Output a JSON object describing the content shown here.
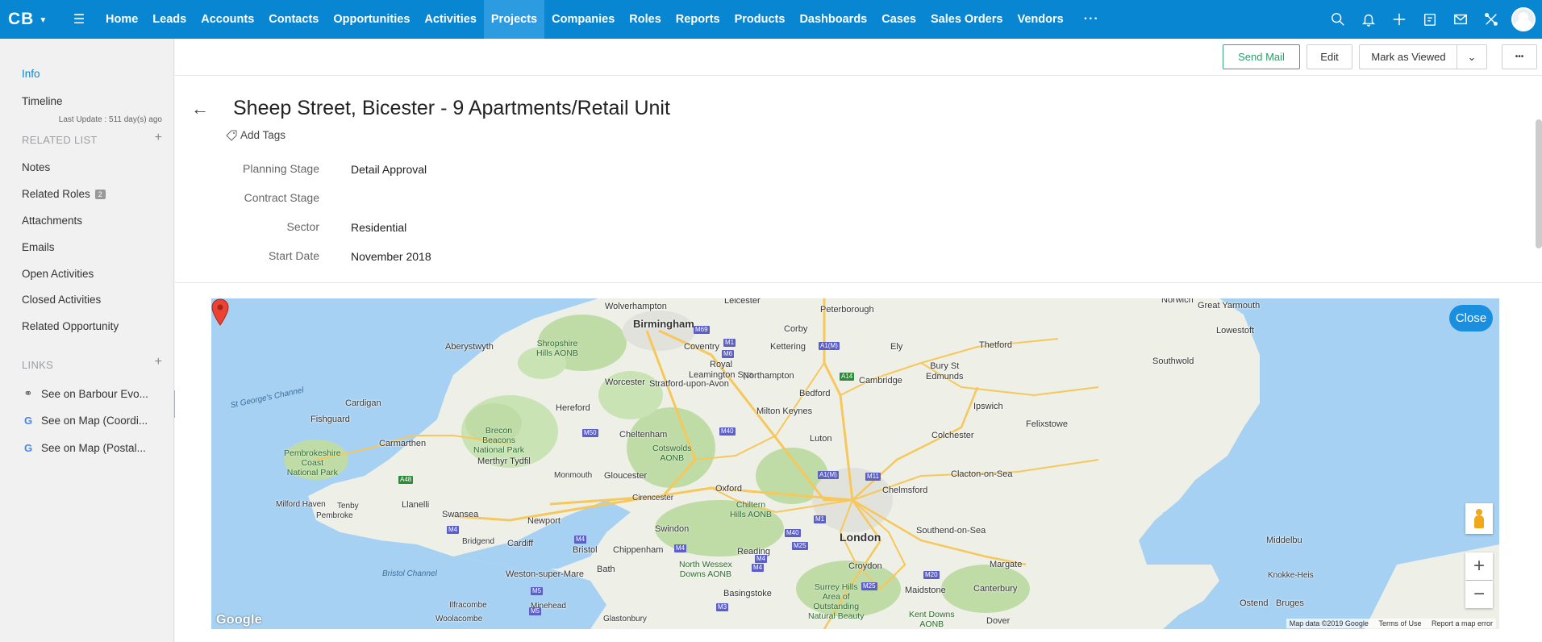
{
  "app": {
    "logo": "CB"
  },
  "nav": {
    "items": [
      "Home",
      "Leads",
      "Accounts",
      "Contacts",
      "Opportunities",
      "Activities",
      "Projects",
      "Companies",
      "Roles",
      "Reports",
      "Products",
      "Dashboards",
      "Cases",
      "Sales Orders",
      "Vendors"
    ],
    "active": "Projects",
    "more": "···"
  },
  "top_icons": [
    "search-icon",
    "bell-icon",
    "plus-icon",
    "calendar-icon",
    "mail-icon",
    "tools-icon"
  ],
  "sidebar": {
    "info": "Info",
    "timeline": "Timeline",
    "last_update": "Last Update : 511 day(s) ago",
    "related_list_heading": "RELATED LIST",
    "related": [
      "Notes",
      "Related Roles",
      "Attachments",
      "Emails",
      "Open Activities",
      "Closed Activities",
      "Related Opportunity"
    ],
    "related_roles_count": "2",
    "links_heading": "LINKS",
    "links": [
      "See on Barbour Evo...",
      "See on Map (Coordi...",
      "See on Map (Postal..."
    ]
  },
  "toolbar": {
    "send_mail": "Send Mail",
    "edit": "Edit",
    "mark_viewed": "Mark as Viewed",
    "more": "•••"
  },
  "record": {
    "title": "Sheep Street, Bicester - 9 Apartments/Retail Unit",
    "add_tags": "Add Tags",
    "fields": [
      {
        "label": "Planning Stage",
        "value": "Detail Approval"
      },
      {
        "label": "Contract Stage",
        "value": ""
      },
      {
        "label": "Sector",
        "value": "Residential"
      },
      {
        "label": "Start Date",
        "value": "November 2018"
      }
    ]
  },
  "map": {
    "close": "Close",
    "zoom_in": "+",
    "zoom_out": "−",
    "footer": {
      "data": "Map data ©2019 Google",
      "terms": "Terms of Use",
      "report": "Report a map error"
    },
    "google": "Google",
    "labels": {
      "wolverhampton": "Wolverhampton",
      "birmingham": "Birmingham",
      "leicester": "Leicester",
      "peterborough": "Peterborough",
      "norwich": "Norwich",
      "great_yarmouth": "Great Yarmouth",
      "lowestoft": "Lowestoft",
      "aberystwyth": "Aberystwyth",
      "shropshire": "Shropshire\nHills AONB",
      "coventry": "Coventry",
      "royal_leamington": "Royal\nLeamington Spa",
      "corby": "Corby",
      "kettering": "Kettering",
      "ely": "Ely",
      "thetford": "Thetford",
      "southwold": "Southwold",
      "northampton": "Northampton",
      "bury": "Bury St\nEdmunds",
      "worcester": "Worcester",
      "stratford": "Stratford-upon-Avon",
      "bedford": "Bedford",
      "cambridge": "Cambridge",
      "st_georges": "St George's Channel",
      "cardigan": "Cardigan",
      "hereford": "Hereford",
      "milton_keynes": "Milton Keynes",
      "ipswich": "Ipswich",
      "felixstowe": "Felixstowe",
      "fishguard": "Fishguard",
      "brecon": "Brecon\nBeacons\nNational Park",
      "cheltenham": "Cheltenham",
      "cotswolds": "Cotswolds\nAONB",
      "luton": "Luton",
      "colchester": "Colchester",
      "carmarthen": "Carmarthen",
      "pembrokeshire": "Pembrokeshire\nCoast\nNational Park",
      "merthyr": "Merthyr Tydfil",
      "monmouth": "Monmouth",
      "gloucester": "Gloucester",
      "oxford": "Oxford",
      "chelmsford": "Chelmsford",
      "clacton": "Clacton-on-Sea",
      "milford": "Milford Haven",
      "tenby": "Tenby",
      "pembroke": "Pembroke",
      "llanelli": "Llanelli",
      "swansea": "Swansea",
      "cirencester": "Cirencester",
      "chiltern": "Chiltern\nHills AONB",
      "newport": "Newport",
      "swindon": "Swindon",
      "london": "London",
      "southend": "Southend-on-Sea",
      "middelburg": "Middelbu",
      "bridgend": "Bridgend",
      "cardiff": "Cardiff",
      "bristol": "Bristol",
      "chippenham": "Chippenham",
      "reading": "Reading",
      "weston": "Weston-super-Mare",
      "bath": "Bath",
      "north_wessex": "North Wessex\nDowns AONB",
      "croydon": "Croydon",
      "margate": "Margate",
      "knokke": "Knokke-Heis",
      "bristol_channel": "Bristol Channel",
      "basingstoke": "Basingstoke",
      "surrey_hills": "Surrey Hills\nArea of\nOutstanding\nNatural Beauty",
      "maidstone": "Maidstone",
      "canterbury": "Canterbury",
      "ostend": "Ostend",
      "bruges": "Bruges",
      "ilfracombe": "Ilfracombe",
      "woolacombe": "Woolacombe",
      "minehead": "Minehead",
      "glastonbury": "Glastonbury",
      "kent_downs": "Kent Downs\nAONB",
      "dover": "Dover"
    },
    "roads": [
      "M69",
      "M1",
      "M6",
      "A1(M)",
      "A14",
      "M50",
      "M40",
      "A48",
      "M4",
      "M4",
      "M5",
      "M4",
      "M4",
      "M1",
      "A1(M)",
      "M11",
      "M40",
      "M25",
      "M4",
      "M20",
      "M25",
      "M3",
      "M5"
    ]
  }
}
